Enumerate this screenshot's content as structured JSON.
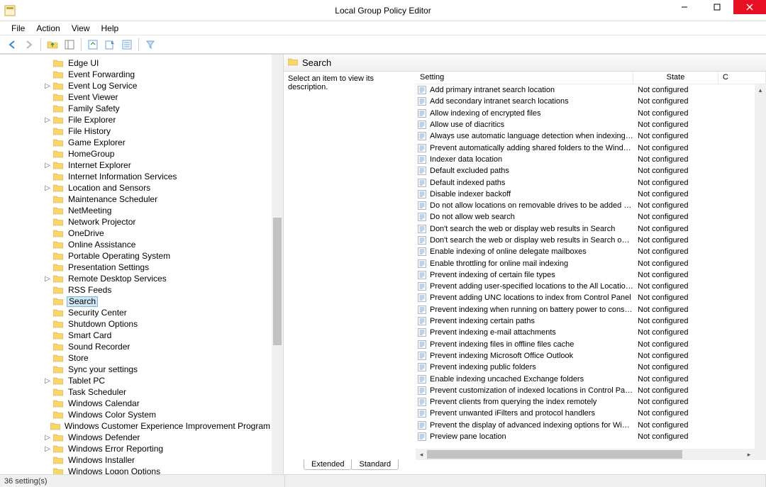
{
  "window": {
    "title": "Local Group Policy Editor"
  },
  "menu": [
    "File",
    "Action",
    "View",
    "Help"
  ],
  "tree": {
    "selected": "Search",
    "items": [
      {
        "label": "Edge UI",
        "indent": 4,
        "expander": ""
      },
      {
        "label": "Event Forwarding",
        "indent": 4,
        "expander": ""
      },
      {
        "label": "Event Log Service",
        "indent": 4,
        "expander": "▷"
      },
      {
        "label": "Event Viewer",
        "indent": 4,
        "expander": ""
      },
      {
        "label": "Family Safety",
        "indent": 4,
        "expander": ""
      },
      {
        "label": "File Explorer",
        "indent": 4,
        "expander": "▷"
      },
      {
        "label": "File History",
        "indent": 4,
        "expander": ""
      },
      {
        "label": "Game Explorer",
        "indent": 4,
        "expander": ""
      },
      {
        "label": "HomeGroup",
        "indent": 4,
        "expander": ""
      },
      {
        "label": "Internet Explorer",
        "indent": 4,
        "expander": "▷"
      },
      {
        "label": "Internet Information Services",
        "indent": 4,
        "expander": ""
      },
      {
        "label": "Location and Sensors",
        "indent": 4,
        "expander": "▷"
      },
      {
        "label": "Maintenance Scheduler",
        "indent": 4,
        "expander": ""
      },
      {
        "label": "NetMeeting",
        "indent": 4,
        "expander": ""
      },
      {
        "label": "Network Projector",
        "indent": 4,
        "expander": ""
      },
      {
        "label": "OneDrive",
        "indent": 4,
        "expander": ""
      },
      {
        "label": "Online Assistance",
        "indent": 4,
        "expander": ""
      },
      {
        "label": "Portable Operating System",
        "indent": 4,
        "expander": ""
      },
      {
        "label": "Presentation Settings",
        "indent": 4,
        "expander": ""
      },
      {
        "label": "Remote Desktop Services",
        "indent": 4,
        "expander": "▷"
      },
      {
        "label": "RSS Feeds",
        "indent": 4,
        "expander": ""
      },
      {
        "label": "Search",
        "indent": 4,
        "expander": "",
        "selected": true
      },
      {
        "label": "Security Center",
        "indent": 4,
        "expander": ""
      },
      {
        "label": "Shutdown Options",
        "indent": 4,
        "expander": ""
      },
      {
        "label": "Smart Card",
        "indent": 4,
        "expander": ""
      },
      {
        "label": "Sound Recorder",
        "indent": 4,
        "expander": ""
      },
      {
        "label": "Store",
        "indent": 4,
        "expander": ""
      },
      {
        "label": "Sync your settings",
        "indent": 4,
        "expander": ""
      },
      {
        "label": "Tablet PC",
        "indent": 4,
        "expander": "▷"
      },
      {
        "label": "Task Scheduler",
        "indent": 4,
        "expander": ""
      },
      {
        "label": "Windows Calendar",
        "indent": 4,
        "expander": ""
      },
      {
        "label": "Windows Color System",
        "indent": 4,
        "expander": ""
      },
      {
        "label": "Windows Customer Experience Improvement Program",
        "indent": 4,
        "expander": ""
      },
      {
        "label": "Windows Defender",
        "indent": 4,
        "expander": "▷"
      },
      {
        "label": "Windows Error Reporting",
        "indent": 4,
        "expander": "▷"
      },
      {
        "label": "Windows Installer",
        "indent": 4,
        "expander": ""
      },
      {
        "label": "Windows Logon Options",
        "indent": 4,
        "expander": ""
      }
    ]
  },
  "right": {
    "header": "Search",
    "description_prompt": "Select an item to view its description.",
    "columns": {
      "setting": "Setting",
      "state": "State",
      "comment": "C"
    },
    "rows": [
      {
        "setting": "Add primary intranet search location",
        "state": "Not configured"
      },
      {
        "setting": "Add secondary intranet search locations",
        "state": "Not configured"
      },
      {
        "setting": "Allow indexing of encrypted files",
        "state": "Not configured"
      },
      {
        "setting": "Allow use of diacritics",
        "state": "Not configured"
      },
      {
        "setting": "Always use automatic language detection when indexing co...",
        "state": "Not configured"
      },
      {
        "setting": "Prevent automatically adding shared folders to the Windo...",
        "state": "Not configured"
      },
      {
        "setting": "Indexer data location",
        "state": "Not configured"
      },
      {
        "setting": "Default excluded paths",
        "state": "Not configured"
      },
      {
        "setting": "Default indexed paths",
        "state": "Not configured"
      },
      {
        "setting": "Disable indexer backoff",
        "state": "Not configured"
      },
      {
        "setting": "Do not allow locations on removable drives to be added to li...",
        "state": "Not configured"
      },
      {
        "setting": "Do not allow web search",
        "state": "Not configured"
      },
      {
        "setting": "Don't search the web or display web results in Search",
        "state": "Not configured"
      },
      {
        "setting": "Don't search the web or display web results in Search over ...",
        "state": "Not configured"
      },
      {
        "setting": "Enable indexing of online delegate mailboxes",
        "state": "Not configured"
      },
      {
        "setting": "Enable throttling for online mail indexing",
        "state": "Not configured"
      },
      {
        "setting": "Prevent indexing of certain file types",
        "state": "Not configured"
      },
      {
        "setting": "Prevent adding user-specified locations to the All Locations ...",
        "state": "Not configured"
      },
      {
        "setting": "Prevent adding UNC locations to index from Control Panel",
        "state": "Not configured"
      },
      {
        "setting": "Prevent indexing when running on battery power to conserv...",
        "state": "Not configured"
      },
      {
        "setting": "Prevent indexing certain paths",
        "state": "Not configured"
      },
      {
        "setting": "Prevent indexing e-mail attachments",
        "state": "Not configured"
      },
      {
        "setting": "Prevent indexing files in offline files cache",
        "state": "Not configured"
      },
      {
        "setting": "Prevent indexing Microsoft Office Outlook",
        "state": "Not configured"
      },
      {
        "setting": "Prevent indexing public folders",
        "state": "Not configured"
      },
      {
        "setting": "Enable indexing uncached Exchange folders",
        "state": "Not configured"
      },
      {
        "setting": "Prevent customization of indexed locations in Control Panel",
        "state": "Not configured"
      },
      {
        "setting": "Prevent clients from querying the index remotely",
        "state": "Not configured"
      },
      {
        "setting": "Prevent unwanted iFilters and protocol handlers",
        "state": "Not configured"
      },
      {
        "setting": "Prevent the display of advanced indexing options for Windo...",
        "state": "Not configured"
      },
      {
        "setting": "Preview pane location",
        "state": "Not configured"
      }
    ],
    "tabs": {
      "extended": "Extended",
      "standard": "Standard"
    }
  },
  "status": {
    "text": "36 setting(s)"
  }
}
